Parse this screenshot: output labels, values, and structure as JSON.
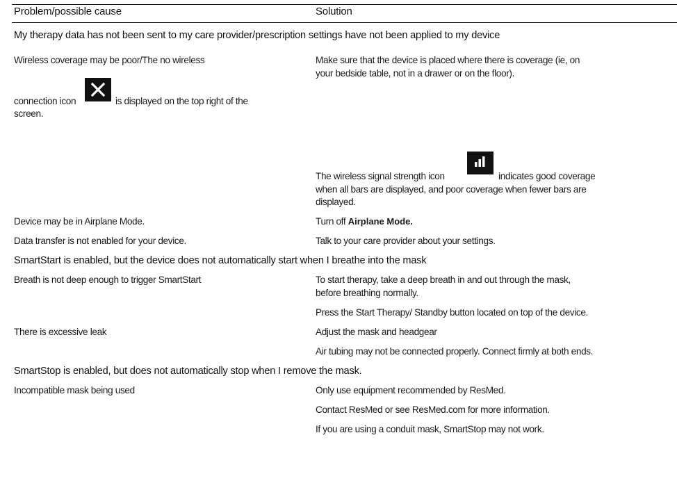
{
  "header": {
    "col1": "Problem/possible cause",
    "col2": "Solution"
  },
  "sections": [
    {
      "title": "My therapy data has not been sent to my care provider/prescription settings have not been applied to my device",
      "rows": [
        {
          "cause_line1": "Wireless coverage may be poor/The no wireless",
          "cause_line2a": "connection icon",
          "cause_icon": "no-wireless-connection-icon",
          "cause_line2b": "is displayed on the top right of the",
          "cause_line3": "screen.",
          "solution_line1": "Make sure that the device is placed where there is coverage (ie, on",
          "solution_line2": "your bedside table, not in a drawer or on the floor)."
        },
        {
          "solution_line1a": "The wireless signal strength icon",
          "solution_icon": "wireless-signal-strength-icon",
          "solution_line1b": "indicates good coverage",
          "solution_line2": "when all bars are displayed, and poor coverage when fewer bars are",
          "solution_line3": "displayed."
        },
        {
          "cause": "Device may be in Airplane Mode.",
          "solution_a": "Turn off",
          "solution_em": "Airplane Mode."
        },
        {
          "cause": "Data transfer is not enabled for your device.",
          "solution": "Talk to your care provider about your settings."
        }
      ]
    },
    {
      "title": "SmartStart is enabled, but the device does not automatically start when I breathe into the mask",
      "rows": [
        {
          "cause": "Breath is not deep enough to trigger SmartStart",
          "solution_line1": "To start therapy, take a deep breath in and out through the mask,",
          "solution_line2": "before breathing normally."
        },
        {
          "solution": "Press the Start Therapy/ Standby button located on top of the device."
        },
        {
          "cause": "There is excessive leak",
          "solution": "Adjust the mask and headgear"
        },
        {
          "solution": "Air tubing may not be connected properly. Connect firmly at both ends."
        }
      ]
    },
    {
      "title": "SmartStop is enabled, but does not automatically stop when I remove the  mask.",
      "rows": [
        {
          "cause": "Incompatible mask being used",
          "solution": "Only use equipment recommended by ResMed."
        },
        {
          "solution": "Contact ResMed or see ResMed.com for more information."
        },
        {
          "solution": "If you are using a conduit mask, SmartStop may not work."
        }
      ]
    }
  ]
}
